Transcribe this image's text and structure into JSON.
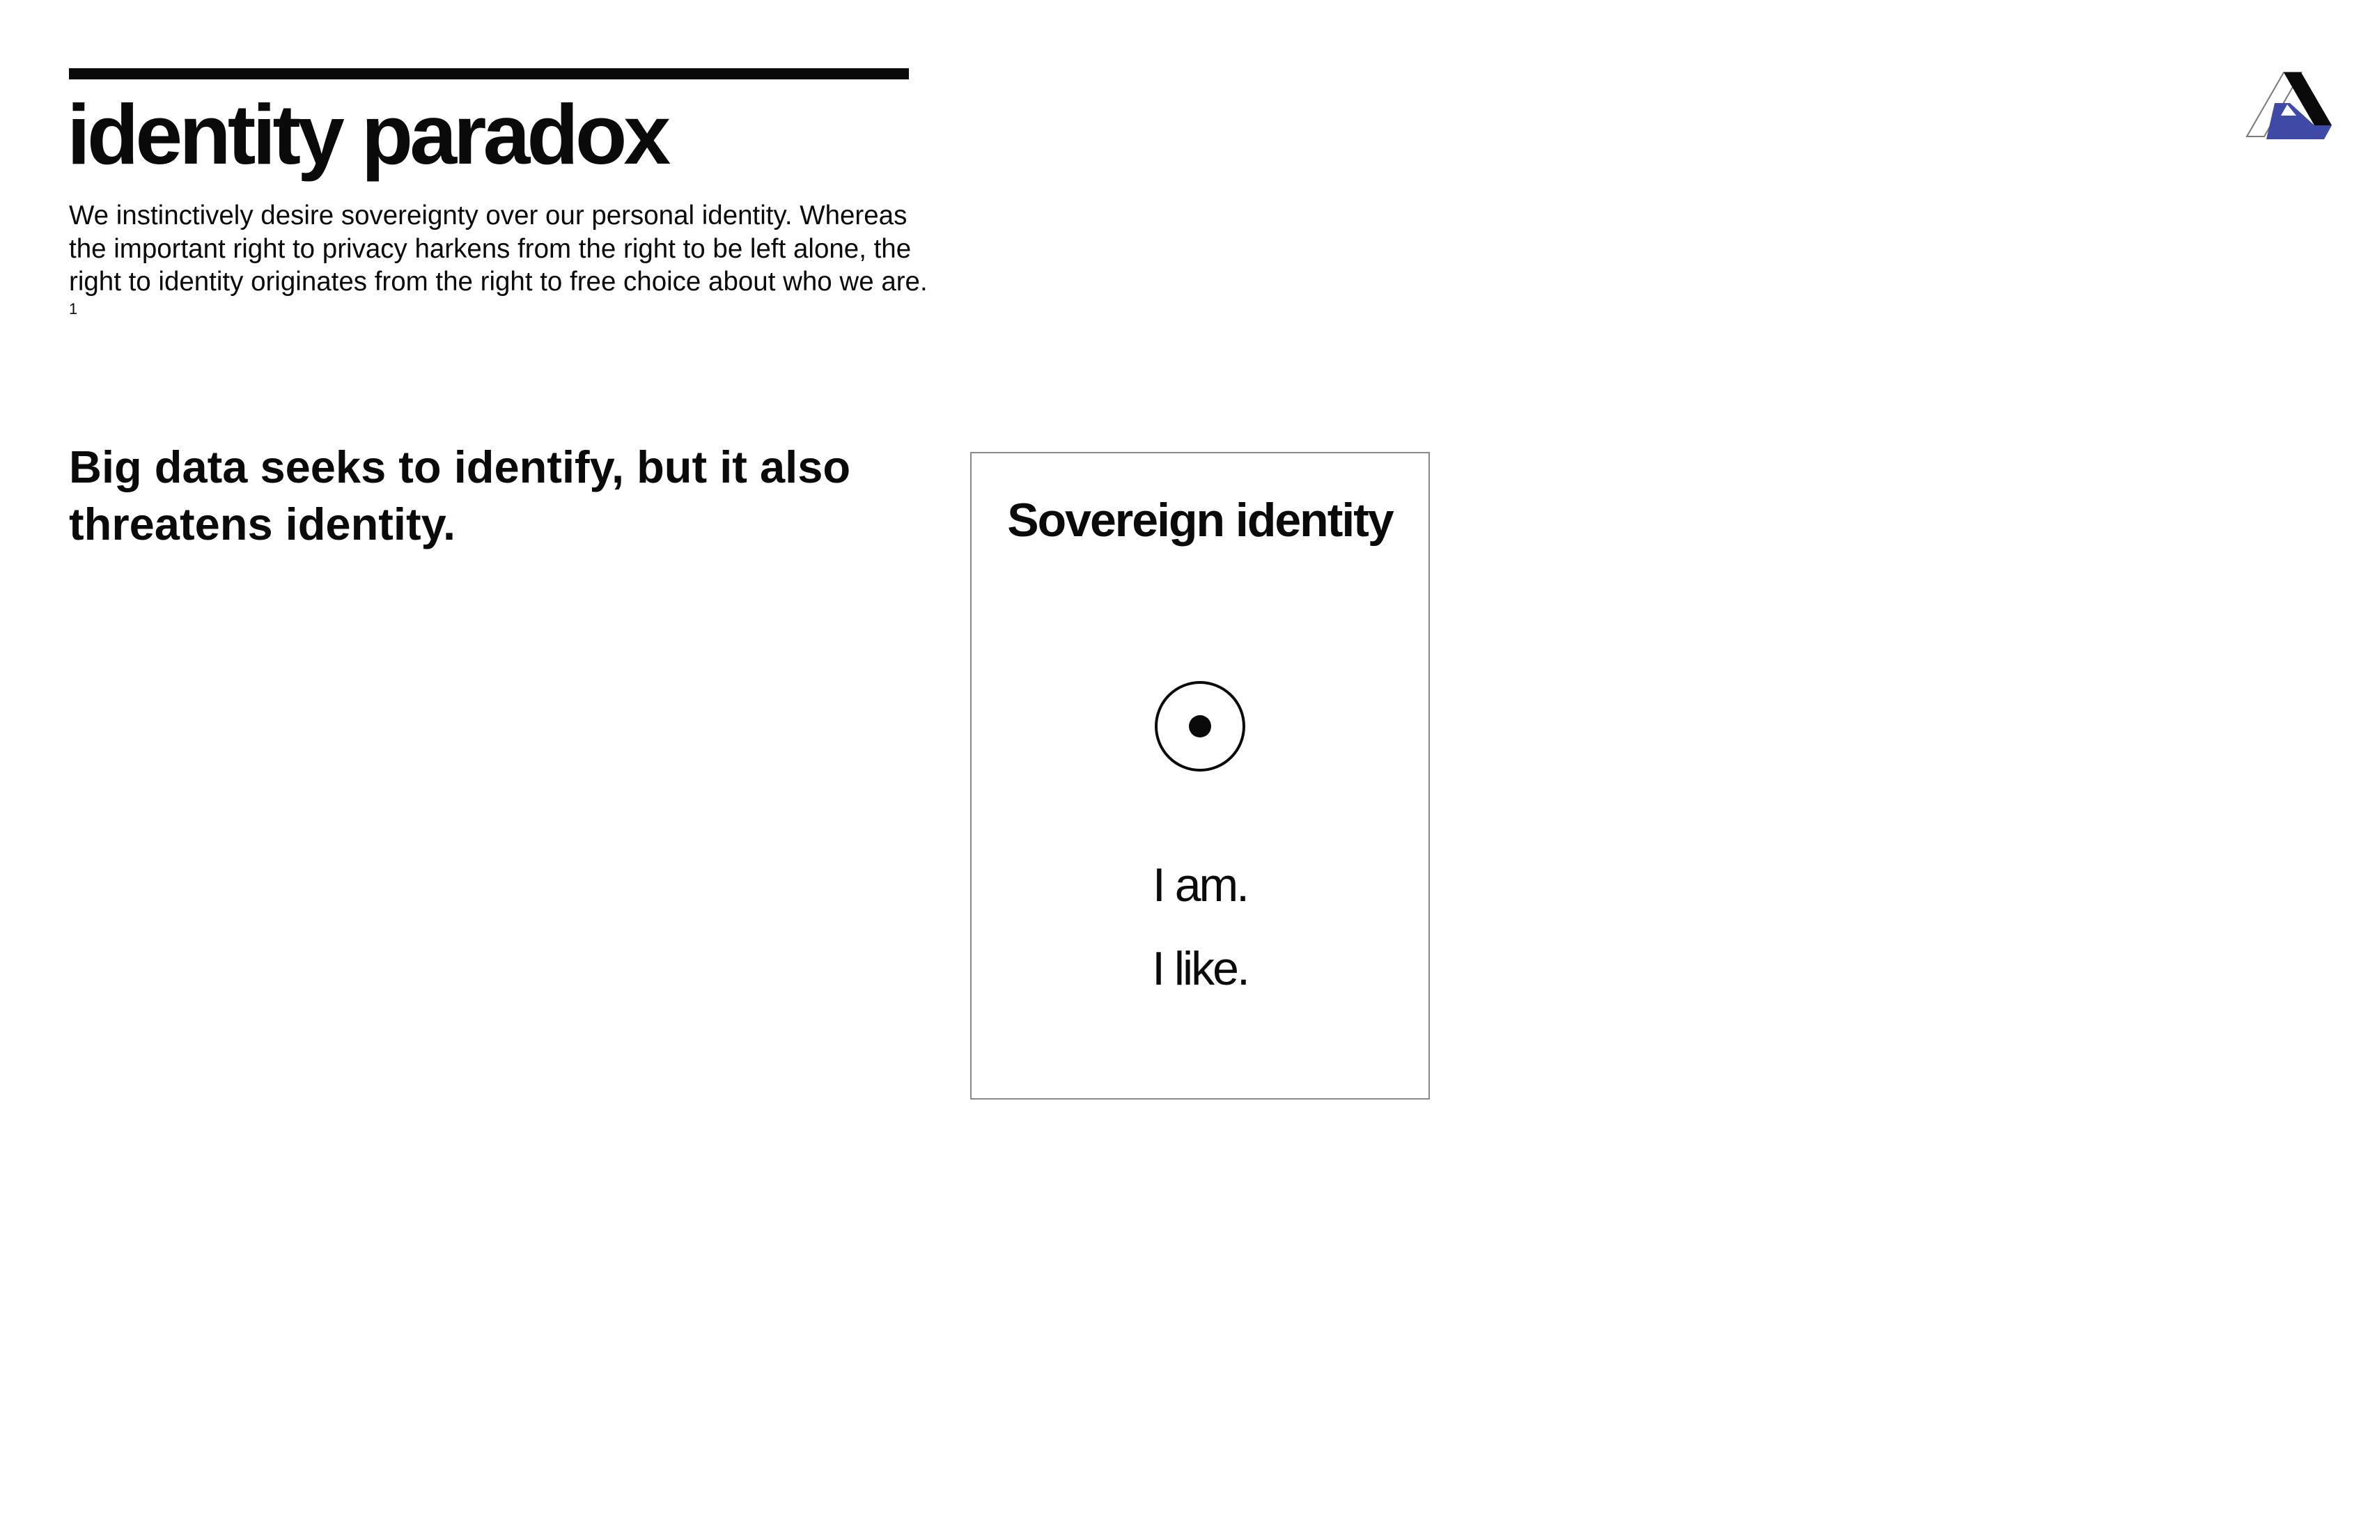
{
  "header": {
    "title": "identity paradox"
  },
  "intro": {
    "text": "We instinctively desire sovereignty over our personal identity. Whereas the important right to privacy harkens from the right to be left alone, the right to identity originates from the right to free choice about who we are.",
    "footnote_marker": "1"
  },
  "statement": {
    "text": "Big data seeks to identify, but it also threatens identity."
  },
  "card": {
    "title": "Sovereign identity",
    "icon": "target-icon",
    "lines": [
      "I am.",
      "I like."
    ]
  },
  "logo": {
    "icon": "triangle-logo-icon",
    "accent_color": "#3f4aa6"
  }
}
